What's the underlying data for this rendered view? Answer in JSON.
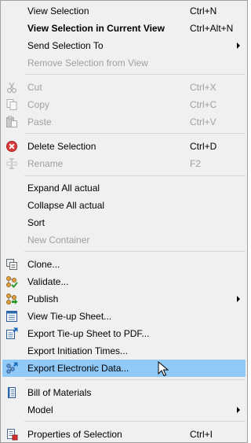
{
  "menu": {
    "items": [
      {
        "label": "View Selection",
        "shortcut": "Ctrl+N",
        "icon": "none"
      },
      {
        "label": "View Selection in Current View",
        "shortcut": "Ctrl+Alt+N",
        "icon": "none"
      },
      {
        "label": "Send Selection To",
        "shortcut": "",
        "icon": "none",
        "submenu": true
      },
      {
        "label": "Remove Selection from View",
        "shortcut": "",
        "icon": "none",
        "disabled": true
      },
      {
        "label": "Cut",
        "shortcut": "Ctrl+X",
        "icon": "cut-icon",
        "disabled": true
      },
      {
        "label": "Copy",
        "shortcut": "Ctrl+C",
        "icon": "copy-icon",
        "disabled": true
      },
      {
        "label": "Paste",
        "shortcut": "Ctrl+V",
        "icon": "paste-icon",
        "disabled": true
      },
      {
        "label": "Delete Selection",
        "shortcut": "Ctrl+D",
        "icon": "delete-icon"
      },
      {
        "label": "Rename",
        "shortcut": "F2",
        "icon": "rename-icon",
        "disabled": true
      },
      {
        "label": "Expand All actual",
        "shortcut": "",
        "icon": "none"
      },
      {
        "label": "Collapse All actual",
        "shortcut": "",
        "icon": "none"
      },
      {
        "label": "Sort",
        "shortcut": "",
        "icon": "none"
      },
      {
        "label": "New Container",
        "shortcut": "",
        "icon": "none",
        "disabled": true
      },
      {
        "label": "Clone...",
        "shortcut": "",
        "icon": "clone-icon"
      },
      {
        "label": "Validate...",
        "shortcut": "",
        "icon": "validate-icon"
      },
      {
        "label": "Publish",
        "shortcut": "",
        "icon": "publish-icon",
        "submenu": true
      },
      {
        "label": "View Tie-up Sheet...",
        "shortcut": "",
        "icon": "tie-up-sheet-icon"
      },
      {
        "label": "Export Tie-up Sheet to PDF...",
        "shortcut": "",
        "icon": "export-pdf-icon"
      },
      {
        "label": "Export Initiation Times...",
        "shortcut": "",
        "icon": "none"
      },
      {
        "label": "Export Electronic Data...",
        "shortcut": "",
        "icon": "export-data-icon",
        "highlighted": true
      },
      {
        "label": "Bill of Materials",
        "shortcut": "",
        "icon": "bill-of-materials-icon"
      },
      {
        "label": "Model",
        "shortcut": "",
        "icon": "none",
        "submenu": true
      },
      {
        "label": "Properties of Selection",
        "shortcut": "Ctrl+I",
        "icon": "properties-icon"
      }
    ]
  },
  "colors": {
    "menu_bg": "#f0f0f0",
    "highlight": "#91c9f7",
    "disabled_text": "#a0a0a0",
    "separator": "#d7d7d7"
  }
}
